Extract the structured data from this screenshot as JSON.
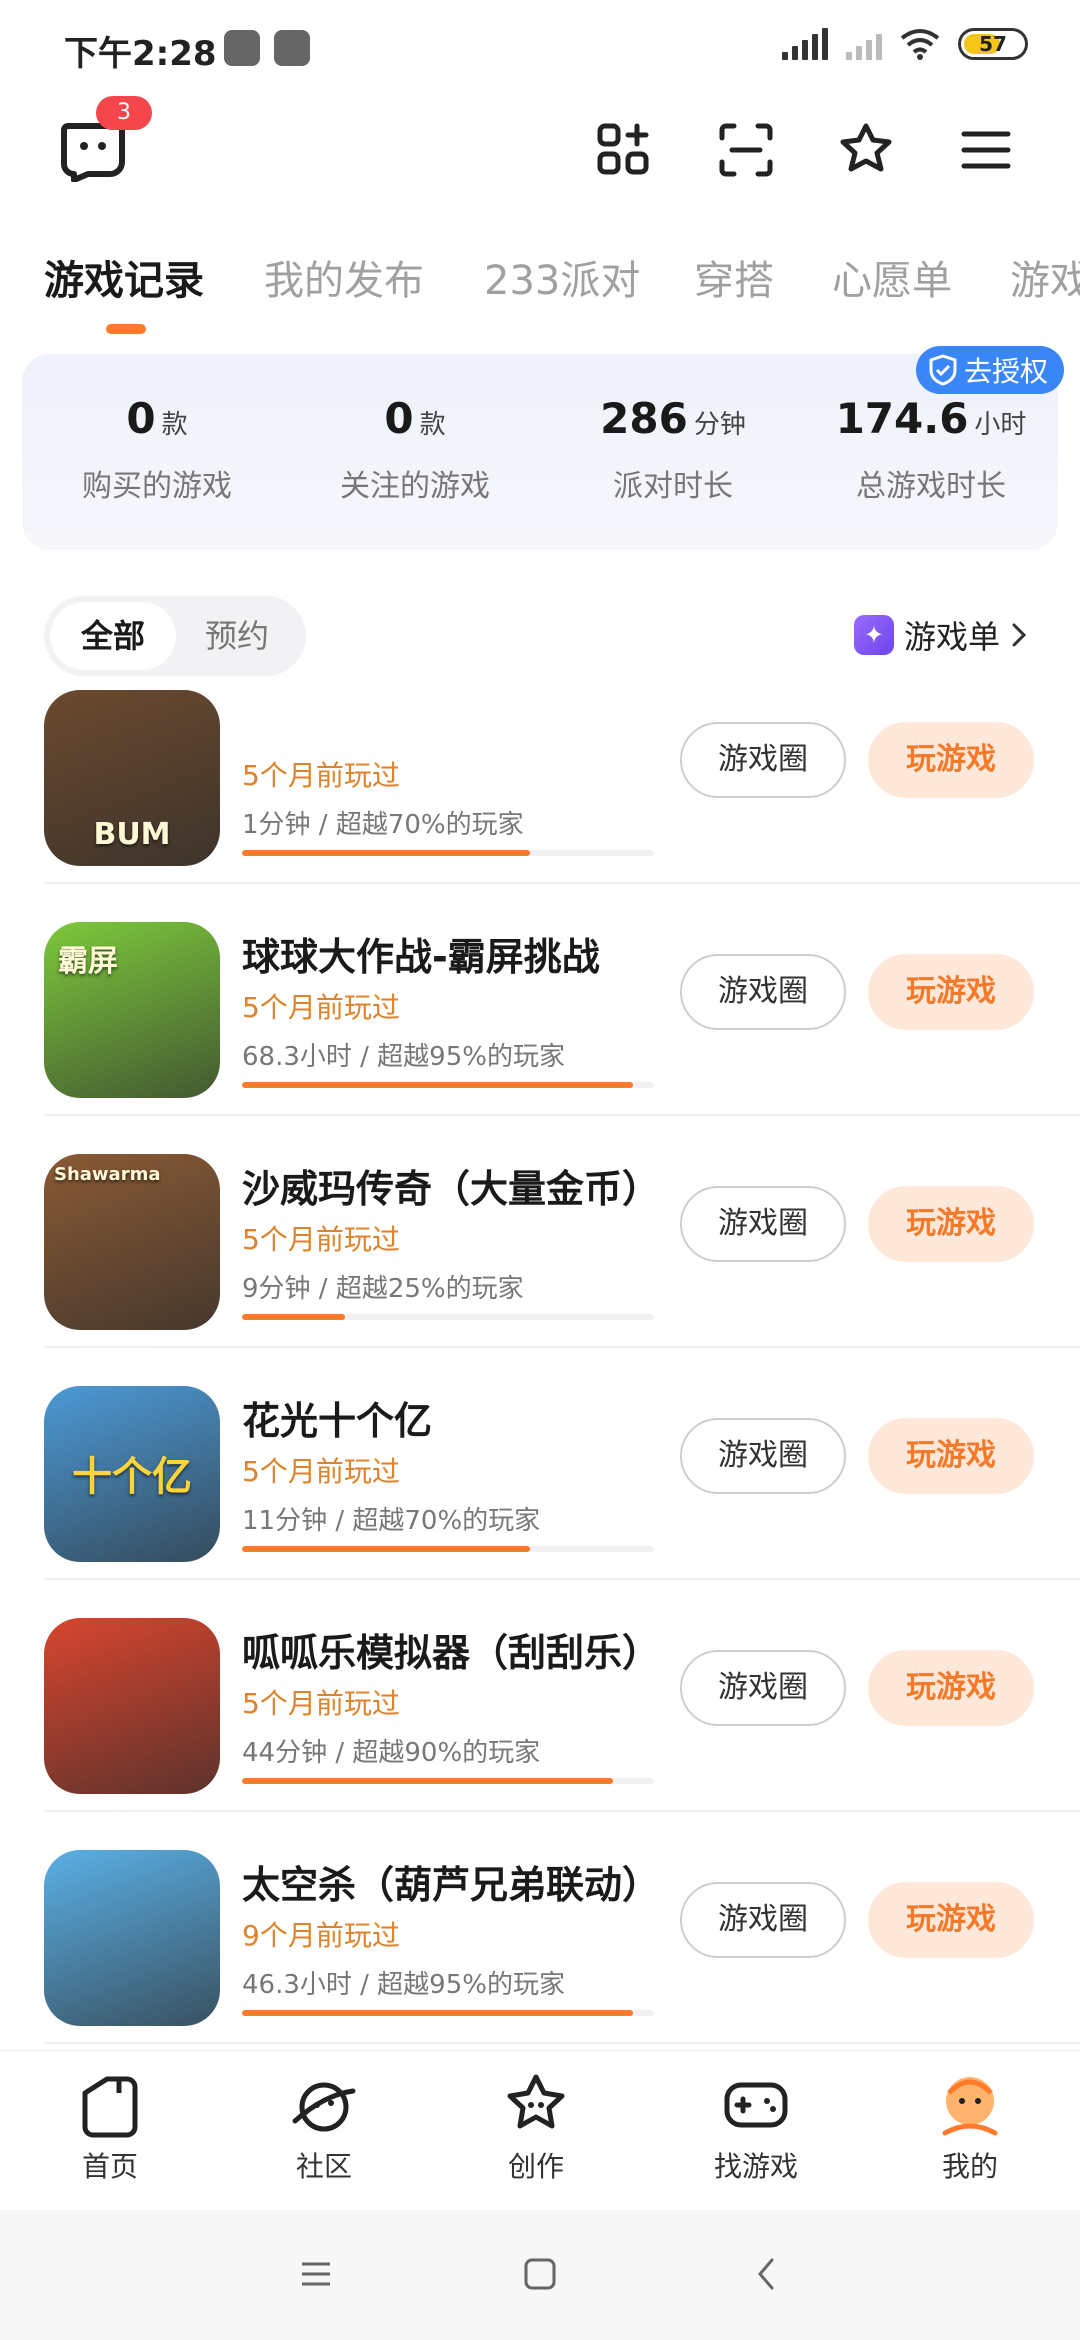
{
  "status_bar": {
    "time": "下午2:28",
    "battery": "57"
  },
  "top": {
    "message_badge": "3"
  },
  "tabs": [
    {
      "label": "游戏记录"
    },
    {
      "label": "我的发布"
    },
    {
      "label": "233派对"
    },
    {
      "label": "穿搭"
    },
    {
      "label": "心愿单"
    },
    {
      "label": "游戏"
    }
  ],
  "stats": {
    "auth_button": "去授权",
    "items": [
      {
        "value": "0",
        "unit": "款",
        "label": "购买的游戏"
      },
      {
        "value": "0",
        "unit": "款",
        "label": "关注的游戏"
      },
      {
        "value": "286",
        "unit": "分钟",
        "label": "派对时长"
      },
      {
        "value": "174.6",
        "unit": "小时",
        "label": "总游戏时长"
      }
    ]
  },
  "filter": {
    "all": "全部",
    "reserve": "预约",
    "game_list": "游戏单"
  },
  "buttons": {
    "circle": "游戏圈",
    "play": "玩游戏"
  },
  "games": [
    {
      "title": "",
      "last_played": "5个月前玩过",
      "meta": "1分钟 / 超越70%的玩家",
      "progress": 0.7,
      "thumb_text": "BUM",
      "thumb_color": "#6b4a2e"
    },
    {
      "title": "球球大作战-霸屏挑战",
      "last_played": "5个月前玩过",
      "meta": "68.3小时 / 超越95%的玩家",
      "progress": 0.95,
      "thumb_text": "霸屏",
      "thumb_color": "#7dc93c"
    },
    {
      "title": "沙威玛传奇（大量金币）",
      "last_played": "5个月前玩过",
      "meta": "9分钟 / 超越25%的玩家",
      "progress": 0.25,
      "thumb_text": "Shawarma",
      "thumb_color": "#8a5a34"
    },
    {
      "title": "花光十个亿",
      "last_played": "5个月前玩过",
      "meta": "11分钟 / 超越70%的玩家",
      "progress": 0.7,
      "thumb_text": "十个亿",
      "thumb_color": "#4c9ad6"
    },
    {
      "title": "呱呱乐模拟器（刮刮乐）",
      "last_played": "5个月前玩过",
      "meta": "44分钟 / 超越90%的玩家",
      "progress": 0.9,
      "thumb_text": "",
      "thumb_color": "#d8452e"
    },
    {
      "title": "太空杀（葫芦兄弟联动）",
      "last_played": "9个月前玩过",
      "meta": "46.3小时 / 超越95%的玩家",
      "progress": 0.95,
      "thumb_text": "",
      "thumb_color": "#5ab0e6"
    },
    {
      "title": "",
      "last_played": "",
      "meta": "",
      "progress": 0,
      "thumb_text": "",
      "thumb_color": "#333333"
    }
  ],
  "bottom_nav": [
    {
      "label": "首页",
      "icon": "home-icon"
    },
    {
      "label": "社区",
      "icon": "planet-icon"
    },
    {
      "label": "创作",
      "icon": "star-icon"
    },
    {
      "label": "找游戏",
      "icon": "gamepad-icon"
    },
    {
      "label": "我的",
      "icon": "avatar-icon"
    }
  ],
  "colors": {
    "accent": "#ff7a2a",
    "play_bg": "#ffe8d9",
    "auth": "#3a86f6"
  }
}
